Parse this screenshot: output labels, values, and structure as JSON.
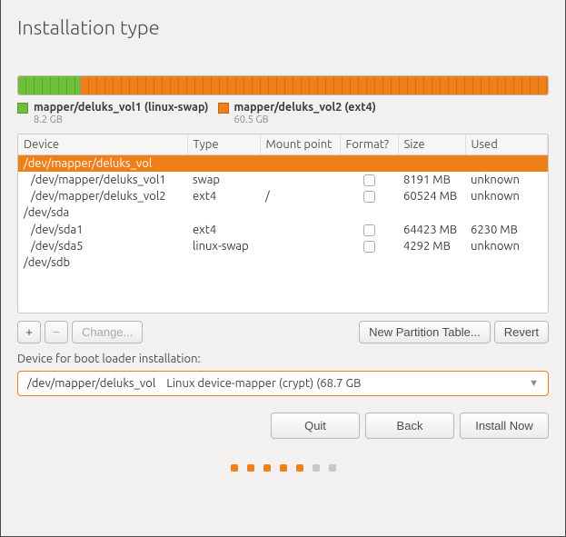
{
  "title": "Installation type",
  "diskbar": {
    "segments": [
      {
        "name": "vol1",
        "percent": 11.9
      },
      {
        "name": "vol2",
        "percent": 88.1
      }
    ]
  },
  "legend": [
    {
      "label": "mapper/deluks_vol1 (linux-swap)",
      "size": "8.2 GB",
      "color": "green"
    },
    {
      "label": "mapper/deluks_vol2 (ext4)",
      "size": "60.5 GB",
      "color": "orange"
    }
  ],
  "columns": {
    "device": "Device",
    "type": "Type",
    "mount": "Mount point",
    "format": "Format?",
    "size": "Size",
    "used": "Used"
  },
  "rows": [
    {
      "device": "/dev/mapper/deluks_vol",
      "type": "",
      "mount": "",
      "format": null,
      "size": "",
      "used": "",
      "indent": false,
      "selected": true
    },
    {
      "device": "/dev/mapper/deluks_vol1",
      "type": "swap",
      "mount": "",
      "format": false,
      "size": "8191 MB",
      "used": "unknown",
      "indent": true,
      "selected": false
    },
    {
      "device": "/dev/mapper/deluks_vol2",
      "type": "ext4",
      "mount": "/",
      "format": false,
      "size": "60524 MB",
      "used": "unknown",
      "indent": true,
      "selected": false
    },
    {
      "device": "/dev/sda",
      "type": "",
      "mount": "",
      "format": null,
      "size": "",
      "used": "",
      "indent": false,
      "selected": false
    },
    {
      "device": "/dev/sda1",
      "type": "ext4",
      "mount": "",
      "format": false,
      "size": "64423 MB",
      "used": "6230 MB",
      "indent": true,
      "selected": false
    },
    {
      "device": "/dev/sda5",
      "type": "linux-swap",
      "mount": "",
      "format": false,
      "size": "4292 MB",
      "used": "unknown",
      "indent": true,
      "selected": false
    },
    {
      "device": "/dev/sdb",
      "type": "",
      "mount": "",
      "format": null,
      "size": "",
      "used": "",
      "indent": false,
      "selected": false
    }
  ],
  "toolbar": {
    "add": "+",
    "remove": "−",
    "change": "Change...",
    "newtable": "New Partition Table...",
    "revert": "Revert"
  },
  "bootloader": {
    "label": "Device for boot loader installation:",
    "selected_device": "/dev/mapper/deluks_vol",
    "selected_desc": "Linux device-mapper (crypt) (68.7 GB"
  },
  "footer": {
    "quit": "Quit",
    "back": "Back",
    "install": "Install Now"
  },
  "progress": {
    "total": 7,
    "active": 5
  }
}
